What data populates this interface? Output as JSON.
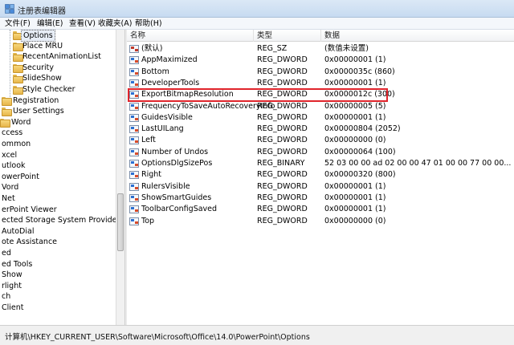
{
  "window": {
    "title": "注册表编辑器"
  },
  "menu": [
    "文件(F)",
    "编辑(E)",
    "查看(V)",
    "收藏夹(A)",
    "帮助(H)"
  ],
  "tree": {
    "items": [
      {
        "label": "Options",
        "selected": true
      },
      {
        "label": "Place MRU"
      },
      {
        "label": "RecentAnimationList"
      },
      {
        "label": "Security"
      },
      {
        "label": "SlideShow"
      },
      {
        "label": "Style Checker"
      },
      {
        "label": "Registration"
      },
      {
        "label": "User Settings"
      },
      {
        "label": "Word"
      },
      {
        "label": "ccess"
      },
      {
        "label": "ommon"
      },
      {
        "label": "xcel"
      },
      {
        "label": "utlook"
      },
      {
        "label": "owerPoint"
      },
      {
        "label": "Vord"
      },
      {
        "label": "Net"
      },
      {
        "label": "erPoint Viewer"
      },
      {
        "label": "ected Storage System Provider"
      },
      {
        "label": "AutoDial"
      },
      {
        "label": "ote Assistance"
      },
      {
        "label": "ed"
      },
      {
        "label": "ed Tools"
      },
      {
        "label": "Show"
      },
      {
        "label": "rlight"
      },
      {
        "label": "ch"
      },
      {
        "label": "Client"
      }
    ]
  },
  "list": {
    "columns": [
      "名称",
      "类型",
      "数据"
    ],
    "rows": [
      {
        "name": "(默认)",
        "type": "REG_SZ",
        "data": "(数值未设置)",
        "icon": "string-value-icon"
      },
      {
        "name": "AppMaximized",
        "type": "REG_DWORD",
        "data": "0x00000001 (1)",
        "icon": "binary-value-icon"
      },
      {
        "name": "Bottom",
        "type": "REG_DWORD",
        "data": "0x0000035c (860)",
        "icon": "binary-value-icon"
      },
      {
        "name": "DeveloperTools",
        "type": "REG_DWORD",
        "data": "0x00000001 (1)",
        "icon": "binary-value-icon"
      },
      {
        "name": "ExportBitmapResolution",
        "type": "REG_DWORD",
        "data": "0x0000012c (300)",
        "icon": "binary-value-icon"
      },
      {
        "name": "FrequencyToSaveAutoRecoveryInfo",
        "type": "REG_DWORD",
        "data": "0x00000005 (5)",
        "icon": "binary-value-icon"
      },
      {
        "name": "GuidesVisible",
        "type": "REG_DWORD",
        "data": "0x00000001 (1)",
        "icon": "binary-value-icon"
      },
      {
        "name": "LastUILang",
        "type": "REG_DWORD",
        "data": "0x00000804 (2052)",
        "icon": "binary-value-icon"
      },
      {
        "name": "Left",
        "type": "REG_DWORD",
        "data": "0x00000000 (0)",
        "icon": "binary-value-icon"
      },
      {
        "name": "Number of Undos",
        "type": "REG_DWORD",
        "data": "0x00000064 (100)",
        "icon": "binary-value-icon"
      },
      {
        "name": "OptionsDlgSizePos",
        "type": "REG_BINARY",
        "data": "52 03 00 00 ad 02 00 00 47 01 00 00 77 00 00...",
        "icon": "binary-value-icon"
      },
      {
        "name": "Right",
        "type": "REG_DWORD",
        "data": "0x00000320 (800)",
        "icon": "binary-value-icon"
      },
      {
        "name": "RulersVisible",
        "type": "REG_DWORD",
        "data": "0x00000001 (1)",
        "icon": "binary-value-icon"
      },
      {
        "name": "ShowSmartGuides",
        "type": "REG_DWORD",
        "data": "0x00000001 (1)",
        "icon": "binary-value-icon"
      },
      {
        "name": "ToolbarConfigSaved",
        "type": "REG_DWORD",
        "data": "0x00000001 (1)",
        "icon": "binary-value-icon"
      },
      {
        "name": "Top",
        "type": "REG_DWORD",
        "data": "0x00000000 (0)",
        "icon": "binary-value-icon"
      }
    ],
    "highlighted_row": "ExportBitmapResolution",
    "highlight_color": "#e0242b"
  },
  "status": {
    "path": "计算机\\HKEY_CURRENT_USER\\Software\\Microsoft\\Office\\14.0\\PowerPoint\\Options"
  }
}
